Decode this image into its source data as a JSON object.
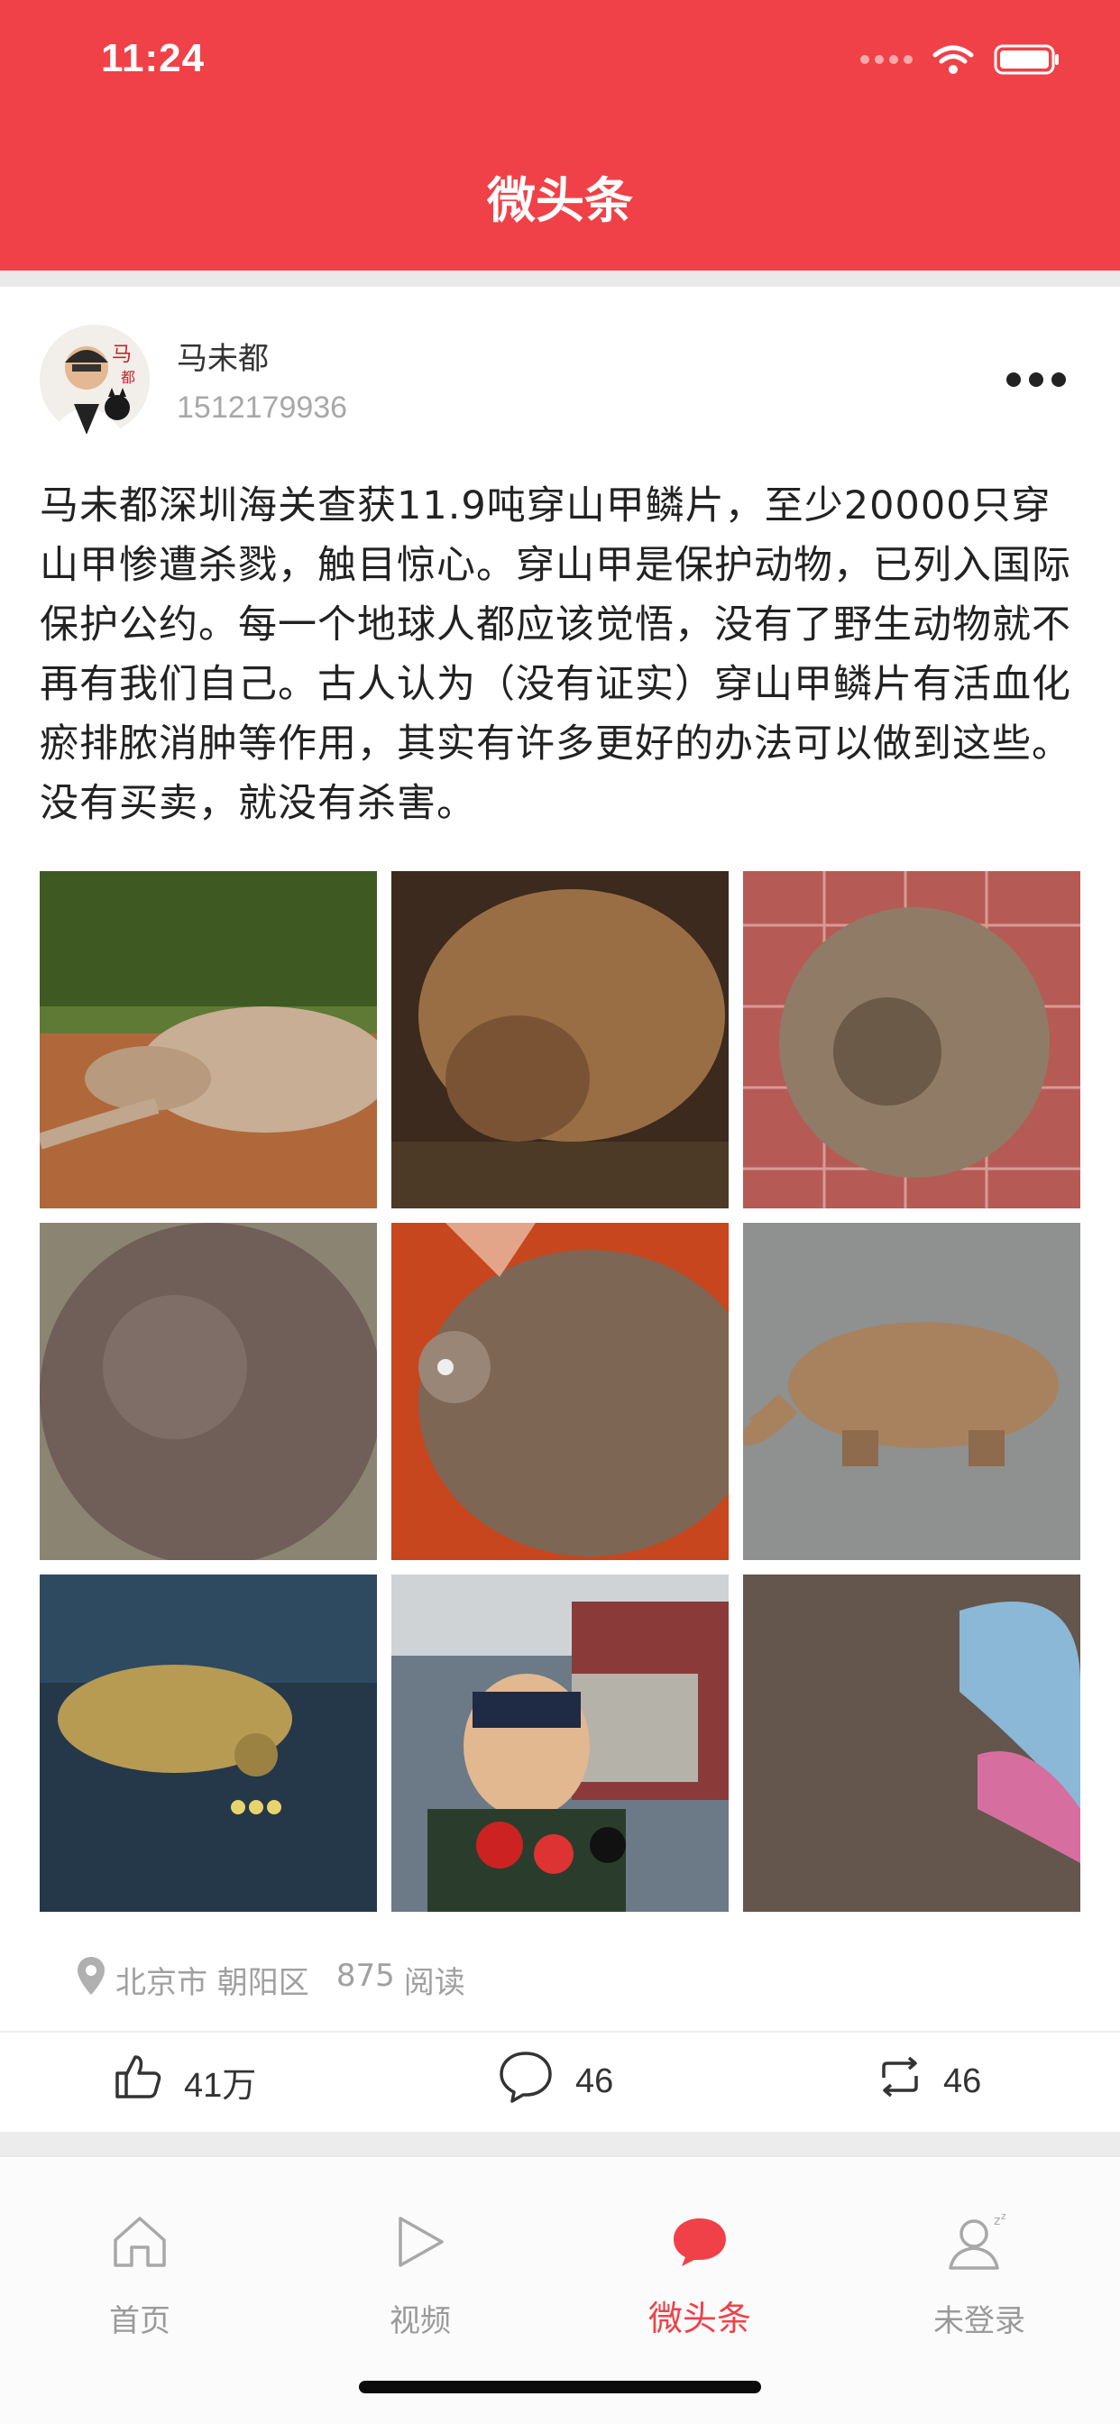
{
  "status_bar": {
    "time": "11:24"
  },
  "header": {
    "title": "微头条"
  },
  "post": {
    "author": {
      "name": "马未都",
      "id": "1512179936"
    },
    "text": "马未都深圳海关查获11.9吨穿山甲鳞片，至少20000只穿山甲惨遭杀戮，触目惊心。穿山甲是保护动物，已列入国际保护公约。每一个地球人都应该觉悟，没有了野生动物就不再有我们自己。古人认为（没有证实）穿山甲鳞片有活血化瘀排脓消肿等作用，其实有许多更好的办法可以做到这些。没有买卖，就没有杀害。",
    "location": "北京市 朝阳区",
    "read_count": "875",
    "read_label": "阅读",
    "likes": "41万",
    "comments": "46",
    "reposts": "46"
  },
  "tabs": [
    {
      "label": "首页",
      "icon": "home-icon"
    },
    {
      "label": "视频",
      "icon": "play-icon"
    },
    {
      "label": "微头条",
      "icon": "chat-bubble-icon",
      "active": true
    },
    {
      "label": "未登录",
      "icon": "user-icon"
    }
  ],
  "colors": {
    "brand": "#f04148",
    "muted": "#a0a0a0"
  }
}
